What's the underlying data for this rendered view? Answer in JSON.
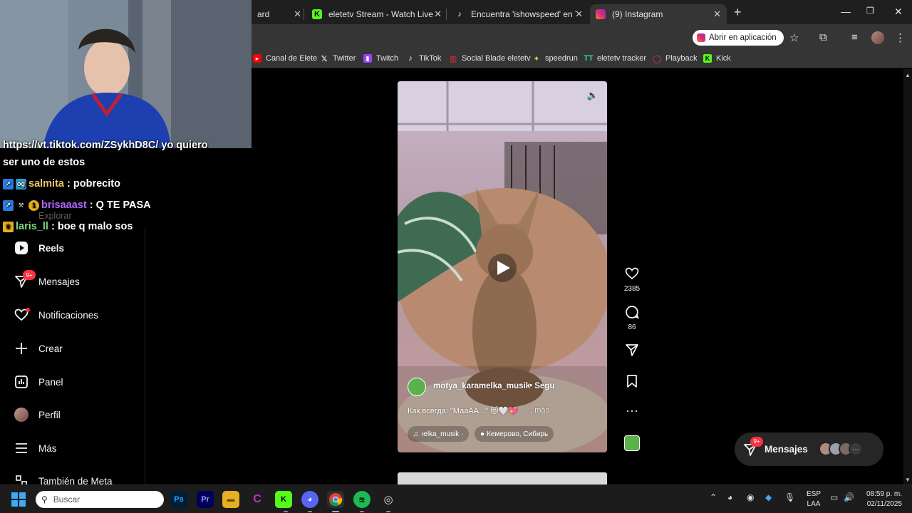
{
  "browser": {
    "tabs": [
      {
        "title": "ard",
        "active": false
      },
      {
        "title": "eletetv Stream - Watch Live on",
        "active": false
      },
      {
        "title": "Encuentra 'ishowspeed' en TikT",
        "active": false
      },
      {
        "title": "(9) Instagram",
        "active": true
      }
    ],
    "open_app_label": "Abrir en aplicación",
    "bookmarks": [
      {
        "label": "Canal de Elete",
        "icon": "youtube-icon",
        "color": "#ff0000"
      },
      {
        "label": "Twitter",
        "icon": "x-icon",
        "color": "#ffffff"
      },
      {
        "label": "Twitch",
        "icon": "twitch-icon",
        "color": "#9146ff"
      },
      {
        "label": "TikTok",
        "icon": "tiktok-icon",
        "color": "#ffffff"
      },
      {
        "label": "Social Blade eletetv",
        "icon": "socialblade-icon",
        "color": "#d9302f"
      },
      {
        "label": "speedrun",
        "icon": "speedrun-icon",
        "color": "#e6c34a"
      },
      {
        "label": "eletetv tracker",
        "icon": "tracker-icon",
        "color": "#3ad6a1"
      },
      {
        "label": "Playback",
        "icon": "playback-icon",
        "color": "#e03c3c"
      },
      {
        "label": "Kick",
        "icon": "kick-icon",
        "color": "#53fc18"
      }
    ]
  },
  "stream_chat": [
    {
      "user": "https://vt.tiktok.com/ZSykhD8C/",
      "message": "yo quiero"
    },
    {
      "user": "",
      "message": "ser uno de estos"
    },
    {
      "user": "salmita",
      "message": ": pobrecito",
      "user_color": "#e8c56a"
    },
    {
      "user": "brisaaast",
      "message": ": Q TE PASA",
      "user_color": "#b266ff"
    },
    {
      "user": "laris_ll",
      "message": ": boe q malo sos",
      "user_color": "#7fd67f"
    }
  ],
  "sidebar": {
    "explore_label": "Explorar",
    "items": [
      {
        "label": "Reels",
        "icon": "reels-icon"
      },
      {
        "label": "Mensajes",
        "icon": "messenger-icon",
        "badge": "9+"
      },
      {
        "label": "Notificaciones",
        "icon": "heart-icon"
      },
      {
        "label": "Crear",
        "icon": "plus-icon"
      },
      {
        "label": "Panel",
        "icon": "dashboard-icon"
      },
      {
        "label": "Perfil",
        "icon": "profile-avatar"
      },
      {
        "label": "Más",
        "icon": "menu-icon"
      },
      {
        "label": "También de Meta",
        "icon": "meta-icon"
      }
    ]
  },
  "reel": {
    "username": "motya_karamelka_musik",
    "follow_label": "Segu",
    "caption": "Как всегда: \"МааАА...\"",
    "more_label": "... más",
    "audio": "ıelka_musik ·",
    "location": "Кемерово, Сибирь",
    "likes": "2385",
    "comments": "86"
  },
  "messages_pill": {
    "label": "Mensajes",
    "badge": "9+"
  },
  "taskbar": {
    "search_placeholder": "Buscar",
    "lang_line1": "ESP",
    "lang_line2": "LAA",
    "time": "08:59 p. m.",
    "date": "02/11/2025"
  }
}
